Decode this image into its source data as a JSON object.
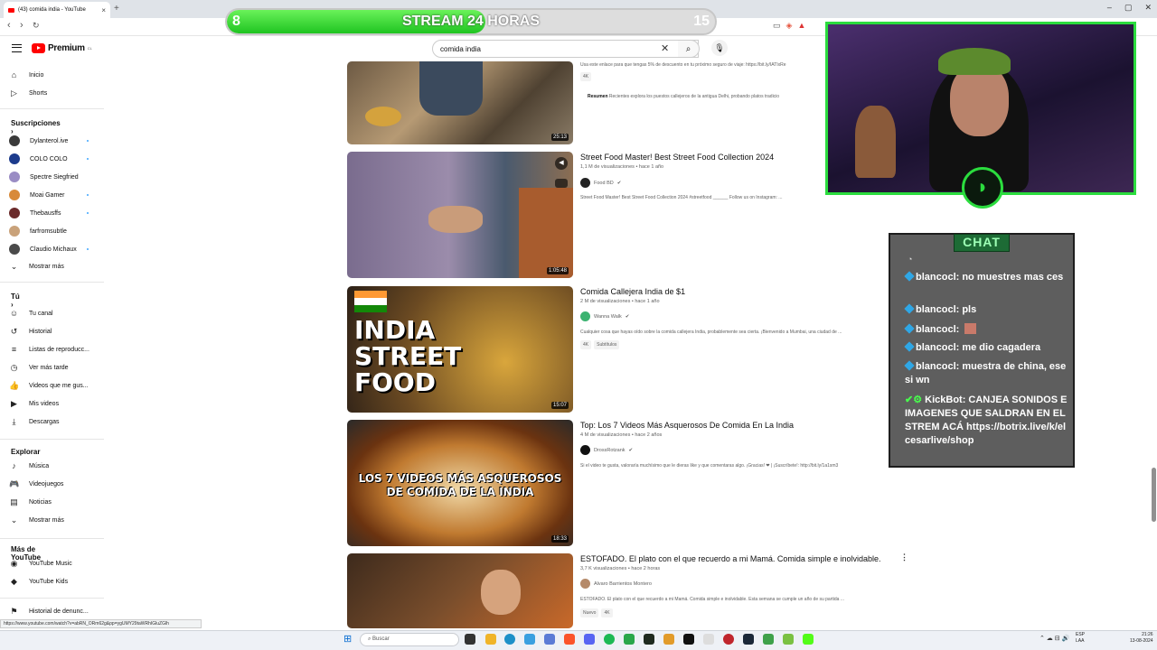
{
  "browser": {
    "tab_title": "(43) comida india - YouTube",
    "tab_close": "×",
    "new_tab": "+",
    "window_controls": [
      "–",
      "▢",
      "✕"
    ],
    "nav_back": "‹",
    "nav_forward": "›",
    "nav_reload": "↻",
    "status_url": "https://www.youtube.com/watch?v=abRN_ORm62g&pp=ygUMY29taWRhIGluZGlh"
  },
  "stream_overlay": {
    "left_number": "8",
    "title": "STREAM 24 HORAS",
    "right_number": "15",
    "progress_fraction": 0.53,
    "fill_color": "#1fc421"
  },
  "header": {
    "logo_text": "Premium",
    "logo_sup": "CL",
    "search_value": "comida india",
    "clear_icon": "✕",
    "search_icon": "⌕",
    "mic_icon": "🎙"
  },
  "sidebar": {
    "top_items": [
      {
        "label": "Inicio",
        "icon": "⌂"
      },
      {
        "label": "Shorts",
        "icon": "▷"
      }
    ],
    "subscriptions_heading": "Suscripciones  ›",
    "subscriptions": [
      {
        "label": "Dylanterol.ive",
        "color": "#3a3a3a",
        "dot": true
      },
      {
        "label": "COLO COLO",
        "color": "#1c3b8c",
        "dot": true
      },
      {
        "label": "Spectre Siegfried",
        "color": "#9a8cc4",
        "dot": false
      },
      {
        "label": "Moai Gamer",
        "color": "#d88a3a",
        "dot": true
      },
      {
        "label": "Thebausffs",
        "color": "#6b2b2b",
        "dot": true
      },
      {
        "label": "farfromsubtle",
        "color": "#c9a27a",
        "dot": false
      },
      {
        "label": "Claudio Michaux",
        "color": "#4a4a4a",
        "dot": true
      }
    ],
    "subs_more": "Mostrar más",
    "you_heading": "Tú  ›",
    "you_items": [
      {
        "label": "Tu canal",
        "icon": "☺"
      },
      {
        "label": "Historial",
        "icon": "↺"
      },
      {
        "label": "Listas de reproducc...",
        "icon": "≡"
      },
      {
        "label": "Ver más tarde",
        "icon": "◷"
      },
      {
        "label": "Videos que me gus...",
        "icon": "👍"
      },
      {
        "label": "Mis videos",
        "icon": "▶"
      },
      {
        "label": "Descargas",
        "icon": "⤓"
      }
    ],
    "explore_heading": "Explorar",
    "explore_items": [
      {
        "label": "Música",
        "icon": "♪"
      },
      {
        "label": "Videojuegos",
        "icon": "🎮"
      },
      {
        "label": "Noticias",
        "icon": "▤"
      },
      {
        "label": "Mostrar más",
        "icon": "⌄"
      }
    ],
    "more_heading": "Más de YouTube",
    "more_items": [
      {
        "label": "YouTube Music",
        "icon": "◉"
      },
      {
        "label": "YouTube Kids",
        "icon": "◆"
      }
    ],
    "bottom_item": {
      "label": "Historial de denunc...",
      "icon": "⚑"
    }
  },
  "videos": [
    {
      "title": "",
      "meta": "",
      "channel": "",
      "desc": "Usa este enlace para que tengas 5% de descuento en tu próximo seguro de viaje: https://bit.ly/IATIxRe",
      "badges": [
        "4K"
      ],
      "summary_label": "Resumen",
      "summary_text": "Recientes explora los puestos callejeros de la antigua Delhi, probando platos tradicio",
      "duration": "25:13"
    },
    {
      "title": "Street Food Master! Best Street Food Collection 2024",
      "meta": "1,1 M de visualizaciones • hace 1 año",
      "channel": "Food BD",
      "desc": "Street Food Master! Best Street Food Collection 2024 #streetfood ______ Follow us on Instagram: ...",
      "badges": [],
      "duration": "1:05:48"
    },
    {
      "title": "Comida Callejera India de $1",
      "meta": "2 M de visualizaciones • hace 1 año",
      "channel": "Wanna Walk",
      "desc": "Cualquier cosa que hayas oído sobre la comida callejera India, probablemente sea cierta. ¡Bienvenido a Mumbai, una ciudad de ...",
      "badges": [
        "4K",
        "Subtítulos"
      ],
      "duration": "15:07",
      "thumb_text": "INDIA STREET FOOD"
    },
    {
      "title": "Top: Los 7 Videos Más Asquerosos De Comida En La India",
      "meta": "4 M de visualizaciones • hace 2 años",
      "channel": "DrossRotzank",
      "desc": "Si el video te gusta, valoraría muchísimo que le dieras like y que comentaras algo. ¡Gracias! ❤ | ¡Suscríbete!: http://bit.ly/1a1sm3",
      "badges": [],
      "duration": "18:33",
      "thumb_text": "LOS 7 VIDEOS MÁS ASQUEROSOS DE COMIDA DE LA INDIA"
    },
    {
      "title": "ESTOFADO. El plato con el que recuerdo a mi Mamá. Comida simple e inolvidable.",
      "meta": "3,7 K visualizaciones • hace 2 horas",
      "channel": "Alvaro Barrientos Montero",
      "desc": "ESTOFADO. El plato con el que recuerdo a mi Mamá. Comida simple e inolvidable. Esta semana se cumple un año de su partida ...",
      "badges": [
        "Nuevo",
        "4K"
      ],
      "duration": ""
    }
  ],
  "chat": {
    "title": "CHAT",
    "messages": [
      "blancocl: no muestres mas ces",
      "blancocl: pls",
      "blancocl: ",
      "blancocl: me dio cagadera",
      "blancocl: muestra de china, ese si wn",
      "KickBot: CANJEA SONIDOS E IMAGENES QUE SALDRAN EN EL STREM ACÁ https://botrix.live/k/elcesarlive/shop"
    ]
  },
  "taskbar": {
    "search_placeholder": "Buscar",
    "lang": "ESP\nLAA",
    "time": "21:26",
    "date": "13-08-2024"
  }
}
